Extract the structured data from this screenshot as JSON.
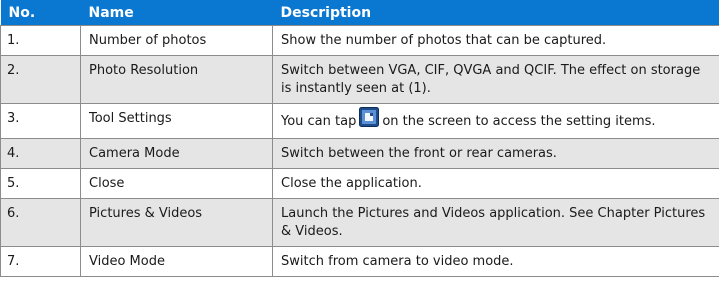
{
  "headers": {
    "no": "No.",
    "name": "Name",
    "description": "Description"
  },
  "rows": [
    {
      "no": "1.",
      "name": "Number of photos",
      "desc": "Show the number of photos that can be captured."
    },
    {
      "no": "2.",
      "name": "Photo Resolution",
      "desc": "Switch between VGA, CIF, QVGA and QCIF. The effect on storage is instantly seen at (1)."
    },
    {
      "no": "3.",
      "name": "Tool Settings",
      "desc_before": "You can tap",
      "desc_after": "on the screen to access the setting items.",
      "icon": "camera-settings-icon"
    },
    {
      "no": "4.",
      "name": "Camera Mode",
      "desc": "Switch between the front or rear cameras."
    },
    {
      "no": "5.",
      "name": "Close",
      "desc": "Close the application."
    },
    {
      "no": "6.",
      "name": "Pictures & Videos",
      "desc": "Launch the Pictures and Videos application. See Chapter Pictures & Videos."
    },
    {
      "no": "7.",
      "name": "Video Mode",
      "desc": "Switch from camera to video mode."
    }
  ],
  "colors": {
    "header_bg": "#0a78d1",
    "header_text": "#ffffff",
    "row_alt_bg": "#e5e5e5",
    "border": "#8c8c8c"
  }
}
